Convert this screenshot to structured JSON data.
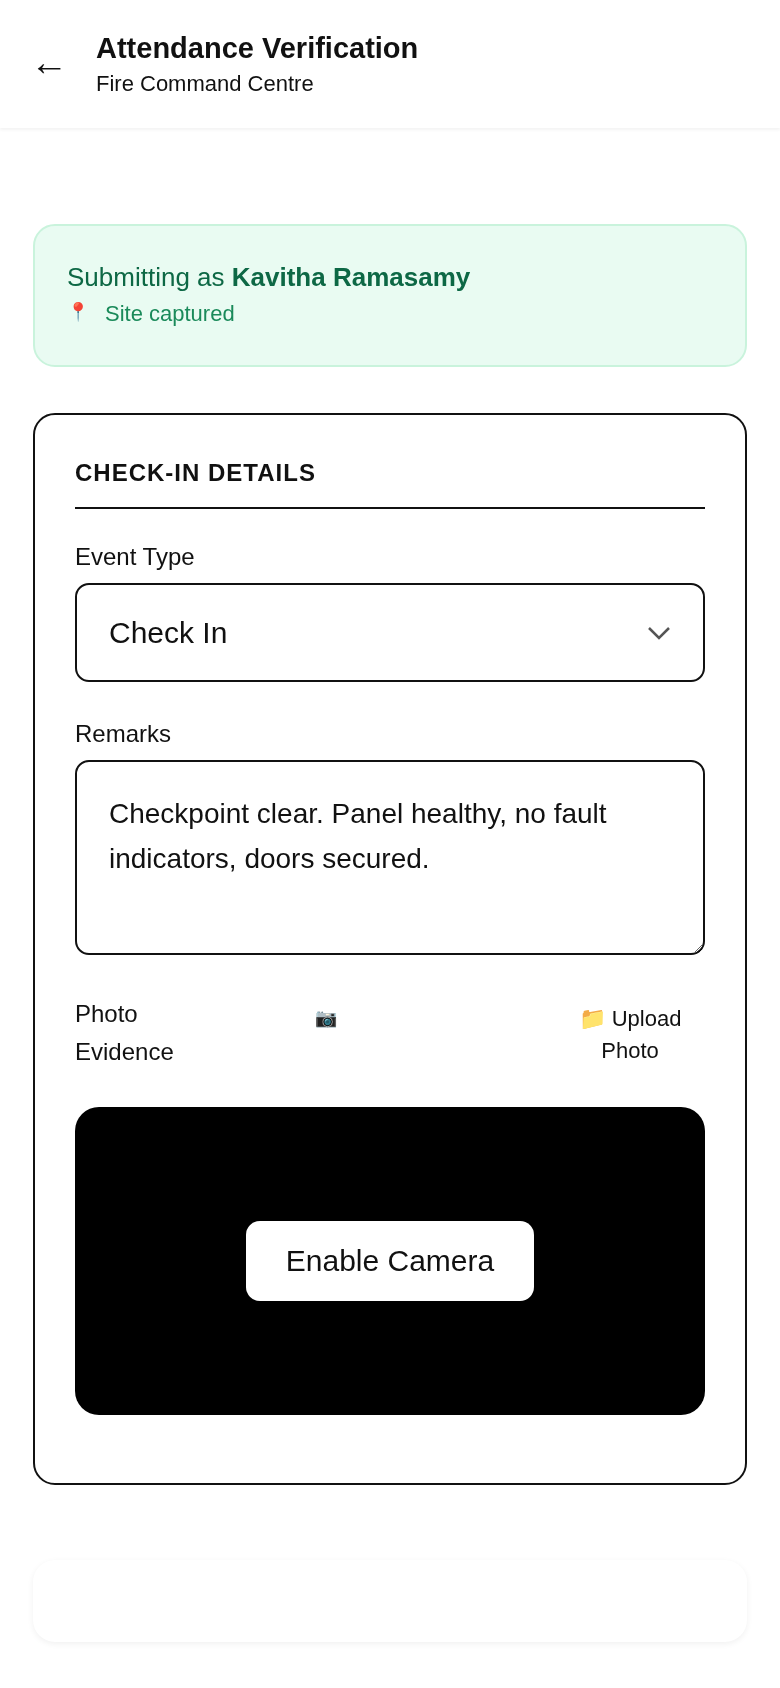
{
  "header": {
    "back_icon": "←",
    "title": "Attendance Verification",
    "subtitle": "Fire Command Centre"
  },
  "banner": {
    "text": "Submitting as **Kavitha Ramasamy**",
    "location_icon": "📍",
    "location": "Site captured"
  },
  "form": {
    "heading": "CHECK-IN DETAILS",
    "event_type": {
      "label": "Event Type",
      "value": "Check In"
    },
    "remarks": {
      "label": "Remarks",
      "value": "Checkpoint clear. Panel healthy, no fault indicators, doors secured."
    },
    "photo": {
      "label": "Photo Evidence",
      "camera_icon": "📷",
      "upload_icon": "📁",
      "upload_label": "Upload Photo",
      "camera_button": "Enable Camera"
    }
  }
}
